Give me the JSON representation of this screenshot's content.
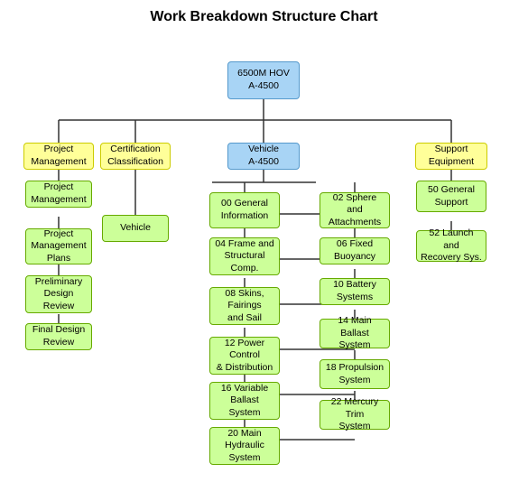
{
  "title": "Work Breakdown Structure Chart",
  "nodes": {
    "root": {
      "label": "6500M HOV\nA-4500"
    },
    "pm": {
      "label": "Project\nManagement"
    },
    "cc": {
      "label": "Certification\nClassification"
    },
    "vehicle": {
      "label": "Vehicle\nA-4500"
    },
    "se": {
      "label": "Support\nEquipment"
    },
    "pm1": {
      "label": "Project\nManagement"
    },
    "pm2": {
      "label": "Project\nManagement\nPlans"
    },
    "pm3": {
      "label": "Preliminary\nDesign\nReview"
    },
    "pm4": {
      "label": "Final Design\nReview"
    },
    "cc1": {
      "label": "Vehicle"
    },
    "v1": {
      "label": "00 General\nInformation"
    },
    "v2": {
      "label": "04 Frame and\nStructural\nComp."
    },
    "v3": {
      "label": "08 Skins,\nFairings\nand Sail"
    },
    "v4": {
      "label": "12 Power\nControl\n& Distribution"
    },
    "v5": {
      "label": "16 Variable\nBallast\nSystem"
    },
    "v6": {
      "label": "20 Main\nHydraulic\nSystem"
    },
    "v7": {
      "label": "02 Sphere and\nAttachments"
    },
    "v8": {
      "label": "06 Fixed\nBuoyancy"
    },
    "v9": {
      "label": "10 Battery\nSystems"
    },
    "v10": {
      "label": "14 Main Ballast\nSystem"
    },
    "v11": {
      "label": "18 Propulsion\nSystem"
    },
    "v12": {
      "label": "22 Mercury Trim\nSystem"
    },
    "se1": {
      "label": "50 General\nSupport"
    },
    "se2": {
      "label": "52 Launch and\nRecovery Sys."
    }
  }
}
